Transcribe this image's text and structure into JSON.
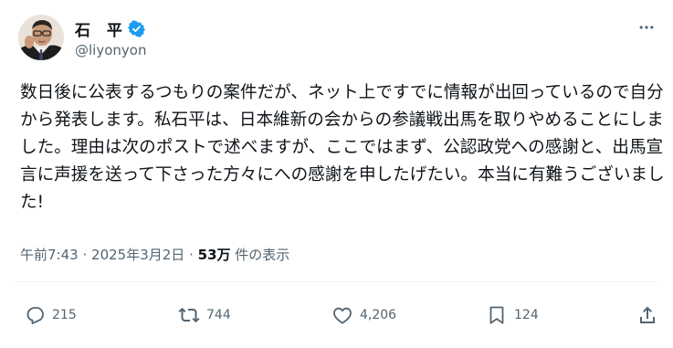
{
  "author": {
    "display_name": "石 平",
    "handle": "@liyonyon",
    "verified_icon": "verified-badge-icon",
    "accent_color": "#1d9bf0"
  },
  "tweet": {
    "text": "数日後に公表するつもりの案件だが、ネット上ですでに情報が出回っているので自分から発表します。私石平は、日本維新の会からの参議戦出馬を取りやめることにしました。理由は次のポストで述べますが、ここではまず、公認政党への感謝と、出馬宣言に声援を送って下さった方々にへの感謝を申したげたい。本当に有難うございました!",
    "time": "午前7:43",
    "separator": "·",
    "date": "2025年3月2日",
    "views": "53万",
    "views_label": "件の表示"
  },
  "actions": {
    "reply": {
      "icon": "reply-icon",
      "count": "215"
    },
    "repost": {
      "icon": "repost-icon",
      "count": "744"
    },
    "like": {
      "icon": "like-icon",
      "count": "4,206"
    },
    "bookmark": {
      "icon": "bookmark-icon",
      "count": "124"
    },
    "share": {
      "icon": "share-icon"
    }
  },
  "more_icon": "more-options-icon"
}
